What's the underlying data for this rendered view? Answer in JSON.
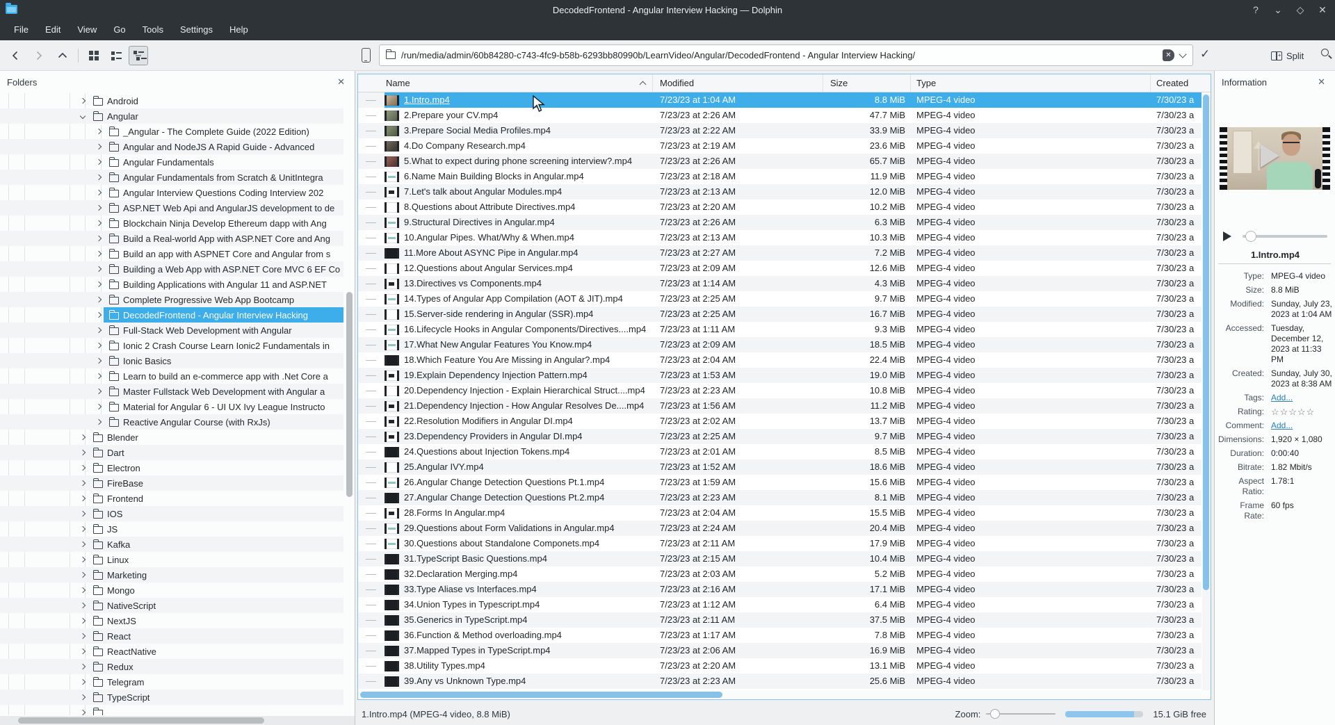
{
  "window": {
    "title": "DecodedFrontend - Angular Interview Hacking — Dolphin",
    "buttons": [
      {
        "name": "help-button",
        "glyph": "?"
      },
      {
        "name": "shade-button",
        "glyph": "⌄"
      },
      {
        "name": "maximize-button",
        "glyph": "◇"
      },
      {
        "name": "close-button",
        "glyph": "✕"
      }
    ]
  },
  "menu": [
    "File",
    "Edit",
    "View",
    "Go",
    "Tools",
    "Settings",
    "Help"
  ],
  "toolbar": {
    "path": "/run/media/admin/60b84280-c743-4fc9-b58b-6293bb80990b/LearnVideo/Angular/DecodedFrontend - Angular Interview Hacking/",
    "split_label": "Split"
  },
  "sidebar": {
    "title": "Folders",
    "items": [
      {
        "label": "Android",
        "depth": 0,
        "expanded": false
      },
      {
        "label": "Angular",
        "depth": 0,
        "expanded": true
      },
      {
        "label": "_Angular - The Complete Guide (2022 Edition)",
        "depth": 1,
        "expanded": false
      },
      {
        "label": "Angular and NodeJS A Rapid Guide - Advanced",
        "depth": 1,
        "expanded": false
      },
      {
        "label": "Angular Fundamentals",
        "depth": 1,
        "expanded": false
      },
      {
        "label": "Angular Fundamentals from Scratch & UnitIntegra",
        "depth": 1,
        "expanded": false
      },
      {
        "label": "Angular Interview Questions Coding Interview 202",
        "depth": 1,
        "expanded": false
      },
      {
        "label": "ASP.NET Web Api and AngularJS development to de",
        "depth": 1,
        "expanded": false
      },
      {
        "label": "Blockchain Ninja  Develop Ethereum dapp with Ang",
        "depth": 1,
        "expanded": false
      },
      {
        "label": "Build a Real-world App with ASP.NET Core and Ang",
        "depth": 1,
        "expanded": false
      },
      {
        "label": "Build an app with ASPNET Core and Angular from s",
        "depth": 1,
        "expanded": false
      },
      {
        "label": "Building a Web App with ASP.NET Core MVC 6 EF Co",
        "depth": 1,
        "expanded": false
      },
      {
        "label": "Building Applications with Angular 11 and ASP.NET",
        "depth": 1,
        "expanded": false
      },
      {
        "label": "Complete Progressive Web App Bootcamp",
        "depth": 1,
        "expanded": false
      },
      {
        "label": "DecodedFrontend - Angular Interview Hacking",
        "depth": 1,
        "expanded": false,
        "selected": true
      },
      {
        "label": "Full-Stack Web Development with Angular",
        "depth": 1,
        "expanded": false
      },
      {
        "label": "Ionic 2 Crash Course Learn Ionic2 Fundamentals in",
        "depth": 1,
        "expanded": false
      },
      {
        "label": "Ionic Basics",
        "depth": 1,
        "expanded": false
      },
      {
        "label": "Learn to build an e-commerce app with .Net Core a",
        "depth": 1,
        "expanded": false
      },
      {
        "label": "Master Fullstack Web Development with Angular a",
        "depth": 1,
        "expanded": false
      },
      {
        "label": "Material for Angular 6 - UI UX Ivy League Instructo",
        "depth": 1,
        "expanded": false
      },
      {
        "label": "Reactive Angular Course (with RxJs)",
        "depth": 1,
        "expanded": false
      },
      {
        "label": "Blender",
        "depth": 0,
        "expanded": false
      },
      {
        "label": "Dart",
        "depth": 0,
        "expanded": false
      },
      {
        "label": "Electron",
        "depth": 0,
        "expanded": false
      },
      {
        "label": "FireBase",
        "depth": 0,
        "expanded": false
      },
      {
        "label": "Frontend",
        "depth": 0,
        "expanded": false
      },
      {
        "label": "IOS",
        "depth": 0,
        "expanded": false
      },
      {
        "label": "JS",
        "depth": 0,
        "expanded": false
      },
      {
        "label": "Kafka",
        "depth": 0,
        "expanded": false
      },
      {
        "label": "Linux",
        "depth": 0,
        "expanded": false
      },
      {
        "label": "Marketing",
        "depth": 0,
        "expanded": false
      },
      {
        "label": "Mongo",
        "depth": 0,
        "expanded": false
      },
      {
        "label": "NativeScript",
        "depth": 0,
        "expanded": false
      },
      {
        "label": "NextJS",
        "depth": 0,
        "expanded": false
      },
      {
        "label": "React",
        "depth": 0,
        "expanded": false
      },
      {
        "label": "ReactNative",
        "depth": 0,
        "expanded": false
      },
      {
        "label": "Redux",
        "depth": 0,
        "expanded": false
      },
      {
        "label": "Telegram",
        "depth": 0,
        "expanded": false
      },
      {
        "label": "TypeScript",
        "depth": 0,
        "expanded": false
      },
      {
        "label": "",
        "depth": 0,
        "expanded": false,
        "partial": true
      }
    ]
  },
  "filelist": {
    "columns": [
      "Name",
      "Modified",
      "Size",
      "Type",
      "Created"
    ],
    "sort_column": "Name",
    "sort_order": "ascending",
    "rows": [
      {
        "name": "1.Intro.mp4",
        "modified": "7/23/23 at 1:04 AM",
        "size": "8.8 MiB",
        "type": "MPEG-4 video",
        "created": "7/30/23 a",
        "thumb": "photo1",
        "selected": true
      },
      {
        "name": "2.Prepare your CV.mp4",
        "modified": "7/23/23 at 2:26 AM",
        "size": "47.7 MiB",
        "type": "MPEG-4 video",
        "created": "7/30/23 a",
        "thumb": "photo2"
      },
      {
        "name": "3.Prepare Social Media Profiles.mp4",
        "modified": "7/23/23 at 2:22 AM",
        "size": "33.9 MiB",
        "type": "MPEG-4 video",
        "created": "7/30/23 a",
        "thumb": "photo3"
      },
      {
        "name": "4.Do Company Research.mp4",
        "modified": "7/23/23 at 2:19 AM",
        "size": "23.6 MiB",
        "type": "MPEG-4 video",
        "created": "7/30/23 a",
        "thumb": "photo4"
      },
      {
        "name": "5.What to expect during phone screening interview?.mp4",
        "modified": "7/23/23 at 2:26 AM",
        "size": "65.7 MiB",
        "type": "MPEG-4 video",
        "created": "7/30/23 a",
        "thumb": "photo5"
      },
      {
        "name": "6.Name Main Building Blocks in Angular.mp4",
        "modified": "7/23/23 at 2:18 AM",
        "size": "11.9 MiB",
        "type": "MPEG-4 video",
        "created": "7/30/23 a",
        "thumb": "teal"
      },
      {
        "name": "7.Let's talk about Angular Modules.mp4",
        "modified": "7/23/23 at 2:13 AM",
        "size": "12.0 MiB",
        "type": "MPEG-4 video",
        "created": "7/30/23 a",
        "thumb": "dmark"
      },
      {
        "name": "8.Questions about Attribute Directives.mp4",
        "modified": "7/23/23 at 2:20 AM",
        "size": "10.2 MiB",
        "type": "MPEG-4 video",
        "created": "7/30/23 a",
        "thumb": "plain"
      },
      {
        "name": "9.Structural Directives in Angular.mp4",
        "modified": "7/23/23 at 2:26 AM",
        "size": "6.3 MiB",
        "type": "MPEG-4 video",
        "created": "7/30/23 a",
        "thumb": "teal"
      },
      {
        "name": "10.Angular Pipes. What/Why & When.mp4",
        "modified": "7/23/23 at 2:13 AM",
        "size": "10.3 MiB",
        "type": "MPEG-4 video",
        "created": "7/30/23 a",
        "thumb": "teal"
      },
      {
        "name": "11.More About ASYNC Pipe in Angular.mp4",
        "modified": "7/23/23 at 2:27 AM",
        "size": "7.2 MiB",
        "type": "MPEG-4 video",
        "created": "7/30/23 a",
        "thumb": "dark"
      },
      {
        "name": "12.Questions about Angular Services.mp4",
        "modified": "7/23/23 at 2:09 AM",
        "size": "12.6 MiB",
        "type": "MPEG-4 video",
        "created": "7/30/23 a",
        "thumb": "plain"
      },
      {
        "name": "13.Directives vs Components.mp4",
        "modified": "7/23/23 at 1:14 AM",
        "size": "4.3 MiB",
        "type": "MPEG-4 video",
        "created": "7/30/23 a",
        "thumb": "dmark"
      },
      {
        "name": "14.Types of Angular App Compilation (AOT & JIT).mp4",
        "modified": "7/23/23 at 2:25 AM",
        "size": "9.7 MiB",
        "type": "MPEG-4 video",
        "created": "7/30/23 a",
        "thumb": "teal"
      },
      {
        "name": "15.Server-side rendering in Angular (SSR).mp4",
        "modified": "7/23/23 at 2:25 AM",
        "size": "16.7 MiB",
        "type": "MPEG-4 video",
        "created": "7/30/23 a",
        "thumb": "plain"
      },
      {
        "name": "16.Lifecycle Hooks in Angular Components/Directives....mp4",
        "modified": "7/23/23 at 1:11 AM",
        "size": "9.3 MiB",
        "type": "MPEG-4 video",
        "created": "7/30/23 a",
        "thumb": "teal"
      },
      {
        "name": "17.What New Angular Features You Know.mp4",
        "modified": "7/23/23 at 2:09 AM",
        "size": "18.5 MiB",
        "type": "MPEG-4 video",
        "created": "7/30/23 a",
        "thumb": "teal"
      },
      {
        "name": "18.Which Feature You Are Missing in Angular?.mp4",
        "modified": "7/23/23 at 2:04 AM",
        "size": "22.4 MiB",
        "type": "MPEG-4 video",
        "created": "7/30/23 a",
        "thumb": "dark"
      },
      {
        "name": "19.Explain Dependency Injection Pattern.mp4",
        "modified": "7/23/23 at 1:53 AM",
        "size": "19.0 MiB",
        "type": "MPEG-4 video",
        "created": "7/30/23 a",
        "thumb": "dmark"
      },
      {
        "name": "20.Dependency Injection - Explain Hierarchical Struct....mp4",
        "modified": "7/23/23 at 2:23 AM",
        "size": "10.8 MiB",
        "type": "MPEG-4 video",
        "created": "7/30/23 a",
        "thumb": "plain"
      },
      {
        "name": "21.Dependency Injection - How Angular Resolves De....mp4",
        "modified": "7/23/23 at 1:56 AM",
        "size": "11.2 MiB",
        "type": "MPEG-4 video",
        "created": "7/30/23 a",
        "thumb": "dmark"
      },
      {
        "name": "22.Resolution Modifiers in Angular DI.mp4",
        "modified": "7/23/23 at 2:02 AM",
        "size": "13.7 MiB",
        "type": "MPEG-4 video",
        "created": "7/30/23 a",
        "thumb": "dmark"
      },
      {
        "name": "23.Dependency Providers in Angular DI.mp4",
        "modified": "7/23/23 at 2:25 AM",
        "size": "9.7 MiB",
        "type": "MPEG-4 video",
        "created": "7/30/23 a",
        "thumb": "dmark"
      },
      {
        "name": "24.Questions about Injection Tokens.mp4",
        "modified": "7/23/23 at 2:01 AM",
        "size": "8.5 MiB",
        "type": "MPEG-4 video",
        "created": "7/30/23 a",
        "thumb": "dark"
      },
      {
        "name": "25.Angular IVY.mp4",
        "modified": "7/23/23 at 1:52 AM",
        "size": "18.6 MiB",
        "type": "MPEG-4 video",
        "created": "7/30/23 a",
        "thumb": "plain"
      },
      {
        "name": "26.Angular Change Detection Questions Pt.1.mp4",
        "modified": "7/23/23 at 1:59 AM",
        "size": "15.6 MiB",
        "type": "MPEG-4 video",
        "created": "7/30/23 a",
        "thumb": "teal"
      },
      {
        "name": "27.Angular Change Detection Questions Pt.2.mp4",
        "modified": "7/23/23 at 2:23 AM",
        "size": "8.1 MiB",
        "type": "MPEG-4 video",
        "created": "7/30/23 a",
        "thumb": "dark"
      },
      {
        "name": "28.Forms In Angular.mp4",
        "modified": "7/23/23 at 2:04 AM",
        "size": "15.5 MiB",
        "type": "MPEG-4 video",
        "created": "7/30/23 a",
        "thumb": "dmark"
      },
      {
        "name": "29.Questions about Form Validations in Angular.mp4",
        "modified": "7/23/23 at 2:24 AM",
        "size": "20.4 MiB",
        "type": "MPEG-4 video",
        "created": "7/30/23 a",
        "thumb": "teal"
      },
      {
        "name": "30.Questions about Standalone Componets.mp4",
        "modified": "7/23/23 at 2:11 AM",
        "size": "17.9 MiB",
        "type": "MPEG-4 video",
        "created": "7/30/23 a",
        "thumb": "teal"
      },
      {
        "name": "31.TypeScript Basic Questions.mp4",
        "modified": "7/23/23 at 2:15 AM",
        "size": "10.4 MiB",
        "type": "MPEG-4 video",
        "created": "7/30/23 a",
        "thumb": "dark"
      },
      {
        "name": "32.Declaration Merging.mp4",
        "modified": "7/23/23 at 2:03 AM",
        "size": "5.2 MiB",
        "type": "MPEG-4 video",
        "created": "7/30/23 a",
        "thumb": "dark"
      },
      {
        "name": "33.Type Aliase vs Interfaces.mp4",
        "modified": "7/23/23 at 2:16 AM",
        "size": "17.1 MiB",
        "type": "MPEG-4 video",
        "created": "7/30/23 a",
        "thumb": "dark"
      },
      {
        "name": "34.Union Types in Typescript.mp4",
        "modified": "7/23/23 at 1:12 AM",
        "size": "6.4 MiB",
        "type": "MPEG-4 video",
        "created": "7/30/23 a",
        "thumb": "dark"
      },
      {
        "name": "35.Generics in TypeScript.mp4",
        "modified": "7/23/23 at 2:11 AM",
        "size": "37.5 MiB",
        "type": "MPEG-4 video",
        "created": "7/30/23 a",
        "thumb": "dark"
      },
      {
        "name": "36.Function & Method overloading.mp4",
        "modified": "7/23/23 at 1:17 AM",
        "size": "7.8 MiB",
        "type": "MPEG-4 video",
        "created": "7/30/23 a",
        "thumb": "dark"
      },
      {
        "name": "37.Mapped Types in TypeScript.mp4",
        "modified": "7/23/23 at 2:06 AM",
        "size": "16.9 MiB",
        "type": "MPEG-4 video",
        "created": "7/30/23 a",
        "thumb": "dark"
      },
      {
        "name": "38.Utility Types.mp4",
        "modified": "7/23/23 at 2:20 AM",
        "size": "13.1 MiB",
        "type": "MPEG-4 video",
        "created": "7/30/23 a",
        "thumb": "dark"
      },
      {
        "name": "39.Any vs Unknown Type.mp4",
        "modified": "7/23/23 at 2:23 AM",
        "size": "25.6 MiB",
        "type": "MPEG-4 video",
        "created": "7/30/23 a",
        "thumb": "dark"
      }
    ]
  },
  "info": {
    "title": "Information",
    "file_title": "1.Intro.mp4",
    "fields": [
      {
        "label": "Type:",
        "value": "MPEG-4 video",
        "kind": "text"
      },
      {
        "label": "Size:",
        "value": "8.8 MiB",
        "kind": "text"
      },
      {
        "label": "Modified:",
        "value": "Sunday, July 23, 2023 at 1:04 AM",
        "kind": "text"
      },
      {
        "label": "Accessed:",
        "value": "Tuesday, December 12, 2023 at 11:33 PM",
        "kind": "text"
      },
      {
        "label": "Created:",
        "value": "Sunday, July 30, 2023 at 8:38 AM",
        "kind": "text"
      },
      {
        "label": "Tags:",
        "value": "Add...",
        "kind": "link"
      },
      {
        "label": "Rating:",
        "value": "☆☆☆☆☆",
        "kind": "stars"
      },
      {
        "label": "Comment:",
        "value": "Add...",
        "kind": "link"
      },
      {
        "label": "Dimensions:",
        "value": "1,920 × 1,080",
        "kind": "text"
      },
      {
        "label": "Duration:",
        "value": "0:00:40",
        "kind": "text"
      },
      {
        "label": "Bitrate:",
        "value": "1.82 Mbit/s",
        "kind": "text"
      },
      {
        "label": "Aspect Ratio:",
        "value": "1.78:1",
        "kind": "text"
      },
      {
        "label": "Frame Rate:",
        "value": "60 fps",
        "kind": "text"
      }
    ]
  },
  "statusbar": {
    "text": "1.Intro.mp4 (MPEG-4 video, 8.8 MiB)",
    "zoom_label": "Zoom:",
    "free_label": "15.1 GiB free"
  },
  "colors": {
    "accent": "#3daee9",
    "titlebar": "#2e3338",
    "selection_text": "#fcfcfc"
  }
}
